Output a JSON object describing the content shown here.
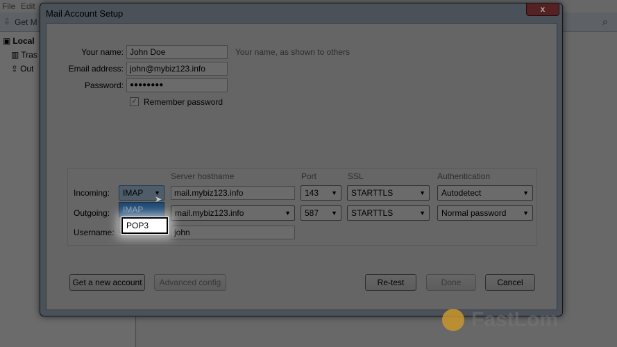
{
  "app": {
    "menu": [
      "File",
      "Edit"
    ],
    "toolbar_get": "Get M",
    "folders": [
      {
        "label": "Local",
        "icon": "computer-icon"
      },
      {
        "label": "Tras",
        "icon": "trash-icon"
      },
      {
        "label": "Out",
        "icon": "outbox-icon"
      }
    ]
  },
  "dialog": {
    "title": "Mail Account Setup",
    "close": "x",
    "name_label": "Your name:",
    "name_value": "John Doe",
    "name_hint": "Your name, as shown to others",
    "email_label": "Email address:",
    "email_value": "john@mybiz123.info",
    "password_label": "Password:",
    "password_value": "●●●●●●●●",
    "remember_label": "Remember password",
    "remember_checked": true,
    "headers": {
      "host": "Server hostname",
      "port": "Port",
      "ssl": "SSL",
      "auth": "Authentication"
    },
    "incoming": {
      "label": "Incoming:",
      "protocol": "IMAP",
      "host": "mail.mybiz123.info",
      "port": "143",
      "ssl": "STARTTLS",
      "auth": "Autodetect"
    },
    "outgoing": {
      "label": "Outgoing:",
      "host": "mail.mybiz123.info",
      "port": "587",
      "ssl": "STARTTLS",
      "auth": "Normal password"
    },
    "username": {
      "label": "Username:",
      "value": "john"
    },
    "protocol_options": [
      "IMAP",
      "POP3"
    ],
    "buttons": {
      "new_account": "Get a new account",
      "advanced": "Advanced config",
      "retest": "Re-test",
      "done": "Done",
      "cancel": "Cancel"
    }
  },
  "watermark": "FastLom"
}
